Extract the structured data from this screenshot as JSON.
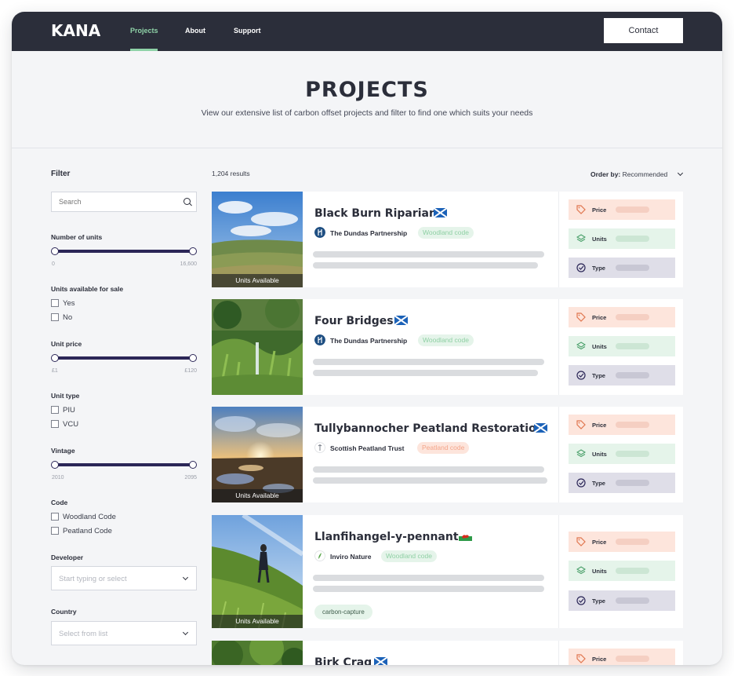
{
  "nav": {
    "logo": "KANA",
    "links": [
      "Projects",
      "About",
      "Support"
    ],
    "active_link": "Projects",
    "contact_label": "Contact"
  },
  "hero": {
    "title": "PROJECTS",
    "subtitle": "View our extensive list of carbon offset projects and filter to find one which suits your needs"
  },
  "filter": {
    "title": "Filter",
    "search_placeholder": "Search",
    "units_label": "Number of units",
    "units_range": {
      "min_label": "0",
      "max_label": "16,600",
      "selected": [
        0,
        16600
      ]
    },
    "available_label": "Units available for sale",
    "available_options": [
      "Yes",
      "No"
    ],
    "price_label": "Unit price",
    "price_range": {
      "min_label": "£1",
      "max_label": "£120",
      "selected": [
        1,
        120
      ]
    },
    "unit_type_label": "Unit type",
    "unit_type_options": [
      "PIU",
      "VCU"
    ],
    "vintage_label": "Vintage",
    "vintage_range": {
      "min_label": "2010",
      "max_label": "2095",
      "selected": [
        2010,
        2095
      ]
    },
    "code_label": "Code",
    "code_options": [
      "Woodland Code",
      "Peatland Code"
    ],
    "developer_label": "Developer",
    "developer_placeholder": "Start typing or select",
    "country_label": "Country",
    "country_placeholder": "Select from list"
  },
  "results": {
    "count": "1,204 results",
    "order_prefix": "Order by:",
    "order_value": "Recommended"
  },
  "attribute_labels": {
    "price": "Price",
    "units": "Units",
    "type": "Type"
  },
  "projects": [
    {
      "title": "Black Burn Riparian",
      "flag": "scotland-flag-icon",
      "developer": "The Dundas Partnership",
      "code": "Woodland code",
      "badge": "Units Available"
    },
    {
      "title": "Four Bridges",
      "flag": "scotland-flag-icon",
      "developer": "The Dundas Partnership",
      "code": "Woodland code",
      "badge": ""
    },
    {
      "title": "Tullybannocher Peatland Restoration",
      "flag": "scotland-flag-icon",
      "developer": "Scottish Peatland Trust",
      "code": "Peatland code",
      "badge": "Units Available"
    },
    {
      "title": "Llanfihangel-y-pennant",
      "flag": "wales-flag-icon",
      "developer": "Inviro Nature",
      "code": "Woodland code",
      "badge": "Units Available",
      "tag": "carbon-capture"
    },
    {
      "title": "Birk Crag",
      "flag": "scotland-flag-icon"
    }
  ],
  "colors": {
    "nav_bg": "#2b2e3a",
    "accent_green": "#8fd3a8",
    "slider": "#2b2657",
    "price_bg": "#fde5dc",
    "units_bg": "#e5f4ea",
    "type_bg": "#dfdee8"
  }
}
